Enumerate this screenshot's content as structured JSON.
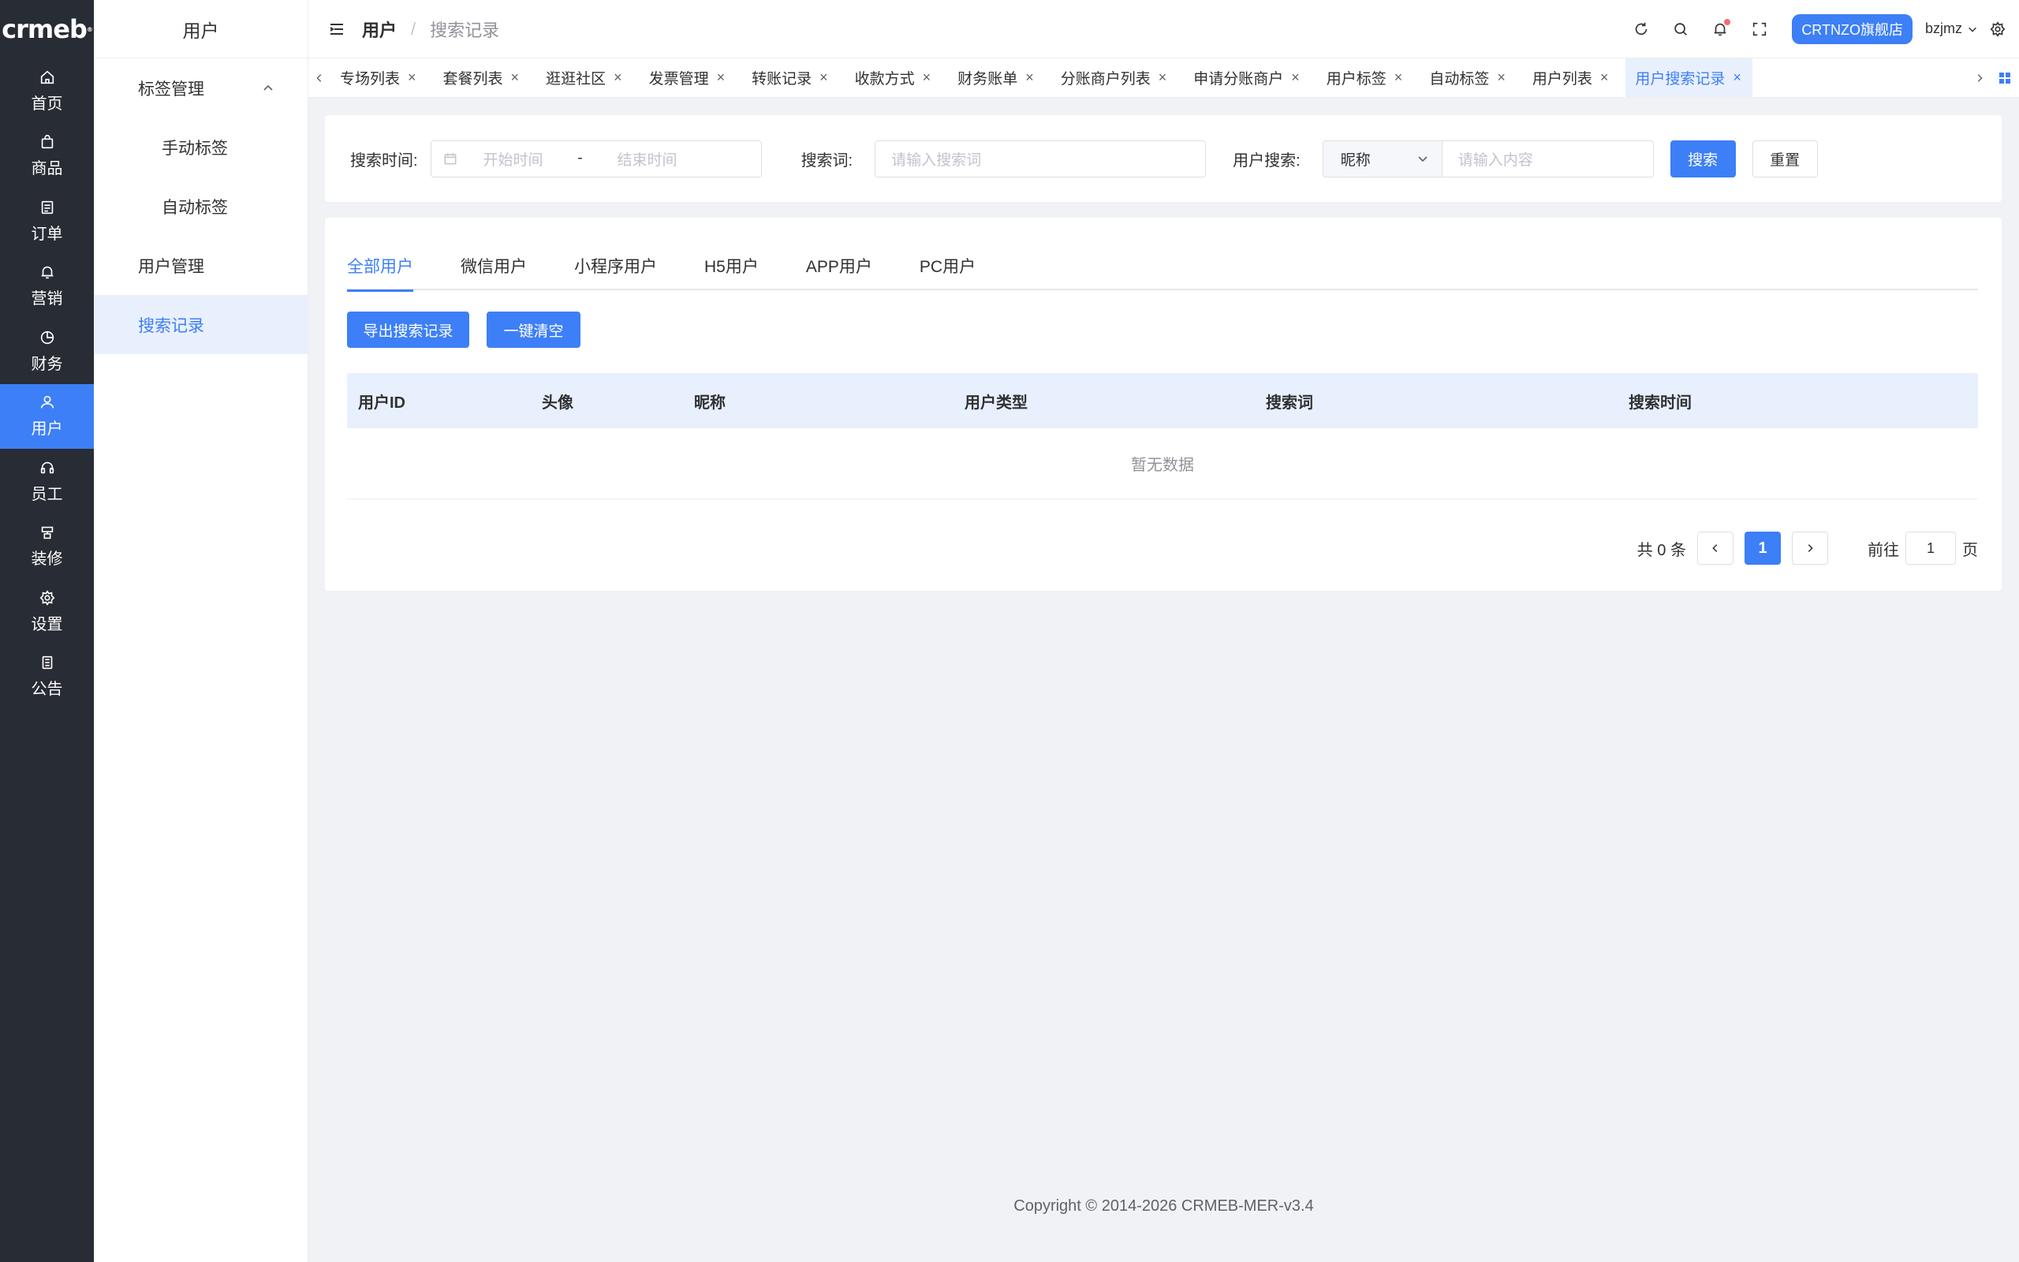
{
  "rail": {
    "logo": "crmeb",
    "items": [
      {
        "label": "首页",
        "icon": "home-icon"
      },
      {
        "label": "商品",
        "icon": "bag-icon"
      },
      {
        "label": "订单",
        "icon": "order-icon"
      },
      {
        "label": "营销",
        "icon": "bell-icon"
      },
      {
        "label": "财务",
        "icon": "pie-chart-icon"
      },
      {
        "label": "用户",
        "icon": "user-icon",
        "active": true
      },
      {
        "label": "员工",
        "icon": "headset-icon"
      },
      {
        "label": "装修",
        "icon": "decorate-icon"
      },
      {
        "label": "设置",
        "icon": "gear-icon"
      },
      {
        "label": "公告",
        "icon": "notice-icon"
      }
    ]
  },
  "subnav": {
    "title": "用户",
    "group_label": "标签管理",
    "group_children": [
      "手动标签",
      "自动标签"
    ],
    "user_manage": "用户管理",
    "search_records": "搜索记录"
  },
  "header": {
    "breadcrumb_root": "用户",
    "breadcrumb_sep": "/",
    "breadcrumb_current": "搜索记录",
    "store_button": "CRTNZO旗舰店",
    "username": "bzjmz"
  },
  "tabs": [
    {
      "label": "专场列表"
    },
    {
      "label": "套餐列表"
    },
    {
      "label": "逛逛社区"
    },
    {
      "label": "发票管理"
    },
    {
      "label": "转账记录"
    },
    {
      "label": "收款方式"
    },
    {
      "label": "财务账单"
    },
    {
      "label": "分账商户列表"
    },
    {
      "label": "申请分账商户"
    },
    {
      "label": "用户标签"
    },
    {
      "label": "自动标签"
    },
    {
      "label": "用户列表"
    },
    {
      "label": "用户搜索记录",
      "active": true
    }
  ],
  "filter": {
    "time_label": "搜索时间:",
    "start_placeholder": "开始时间",
    "range_sep": "-",
    "end_placeholder": "结束时间",
    "keyword_label": "搜索词:",
    "keyword_placeholder": "请输入搜索词",
    "user_label": "用户搜索:",
    "user_select_value": "昵称",
    "user_placeholder": "请输入内容",
    "search_button": "搜索",
    "reset_button": "重置"
  },
  "user_tabs": [
    "全部用户",
    "微信用户",
    "小程序用户",
    "H5用户",
    "APP用户",
    "PC用户"
  ],
  "actions": {
    "export": "导出搜索记录",
    "clear": "一键清空"
  },
  "table": {
    "columns": [
      "用户ID",
      "头像",
      "昵称",
      "用户类型",
      "搜索词",
      "搜索时间"
    ],
    "empty_text": "暂无数据"
  },
  "pagination": {
    "total_text": "共 0 条",
    "current_page": "1",
    "goto_label": "前往",
    "goto_value": "1",
    "page_suffix": "页"
  },
  "footer": "Copyright © 2014-2026 CRMEB-MER-v3.4",
  "colors": {
    "primary": "#3d7ff6",
    "rail_bg": "#282c34",
    "page_bg": "#f0f2f5",
    "table_header_bg": "#e9f0fd"
  }
}
